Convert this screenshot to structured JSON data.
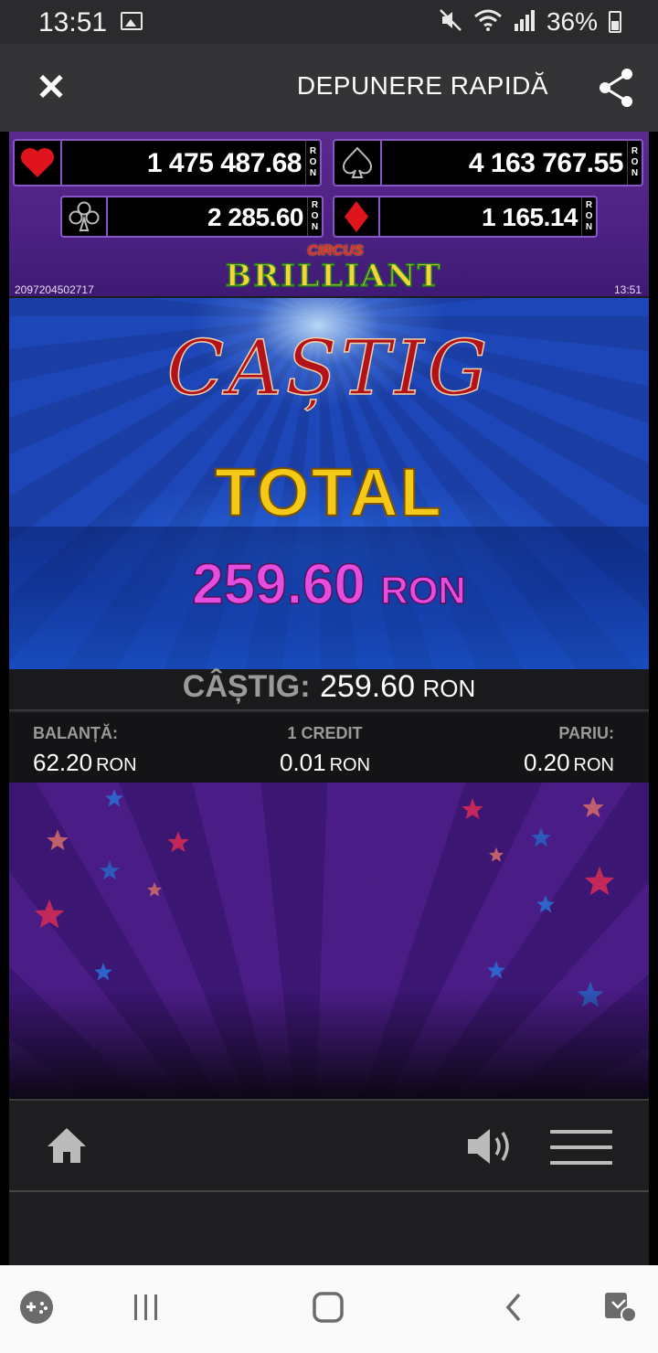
{
  "status_bar": {
    "time": "13:51",
    "battery": "36%",
    "icons": [
      "image-icon",
      "mute-icon",
      "wifi-icon",
      "signal-icon",
      "battery-icon"
    ]
  },
  "header": {
    "title": "DEPUNERE RAPIDĂ",
    "close_icon": "close-icon",
    "share_icon": "share-icon"
  },
  "jackpots": [
    {
      "suit": "heart",
      "value": "1 475 487.68",
      "currency": [
        "R",
        "O",
        "N"
      ],
      "color": "#e0141c"
    },
    {
      "suit": "spade",
      "value": "4 163 767.55",
      "currency": [
        "R",
        "O",
        "N"
      ],
      "color": "#1a1a1a"
    },
    {
      "suit": "club",
      "value": "2 285.60",
      "currency": [
        "R",
        "O",
        "N"
      ],
      "color": "#1a1a1a"
    },
    {
      "suit": "diamond",
      "value": "1 165.14",
      "currency": [
        "R",
        "O",
        "N"
      ],
      "color": "#e0141c"
    }
  ],
  "game": {
    "logo_top": "CIRCUS",
    "logo_main": "BRILLIANT",
    "round_id": "2097204502717",
    "time": "13:51",
    "win_title": "CAȘTIG",
    "win_subtitle": "TOTAL",
    "win_amount": "259.60",
    "win_currency": "RON"
  },
  "win_bar": {
    "label": "CÂȘTIG:",
    "value": "259.60",
    "currency": "RON"
  },
  "info": {
    "balance_label": "BALANȚĂ:",
    "balance_value": "62.20",
    "credit_label": "1 CREDIT",
    "credit_value": "0.01",
    "bet_label": "PARIU:",
    "bet_value": "0.20",
    "currency": "RON"
  },
  "controls": {
    "home_icon": "home-icon",
    "sound_icon": "speaker-icon",
    "menu_icon": "hamburger-menu-icon"
  },
  "nav_bar": {
    "icons": [
      "game-launcher-icon",
      "recent-apps-icon",
      "home-circle-icon",
      "back-icon",
      "screenshot-edit-icon"
    ]
  },
  "colors": {
    "jackpot_border": "#8a55c9",
    "win_title": "#b3121a",
    "win_subtitle": "#f4c917",
    "win_amount": "#e34de0"
  }
}
